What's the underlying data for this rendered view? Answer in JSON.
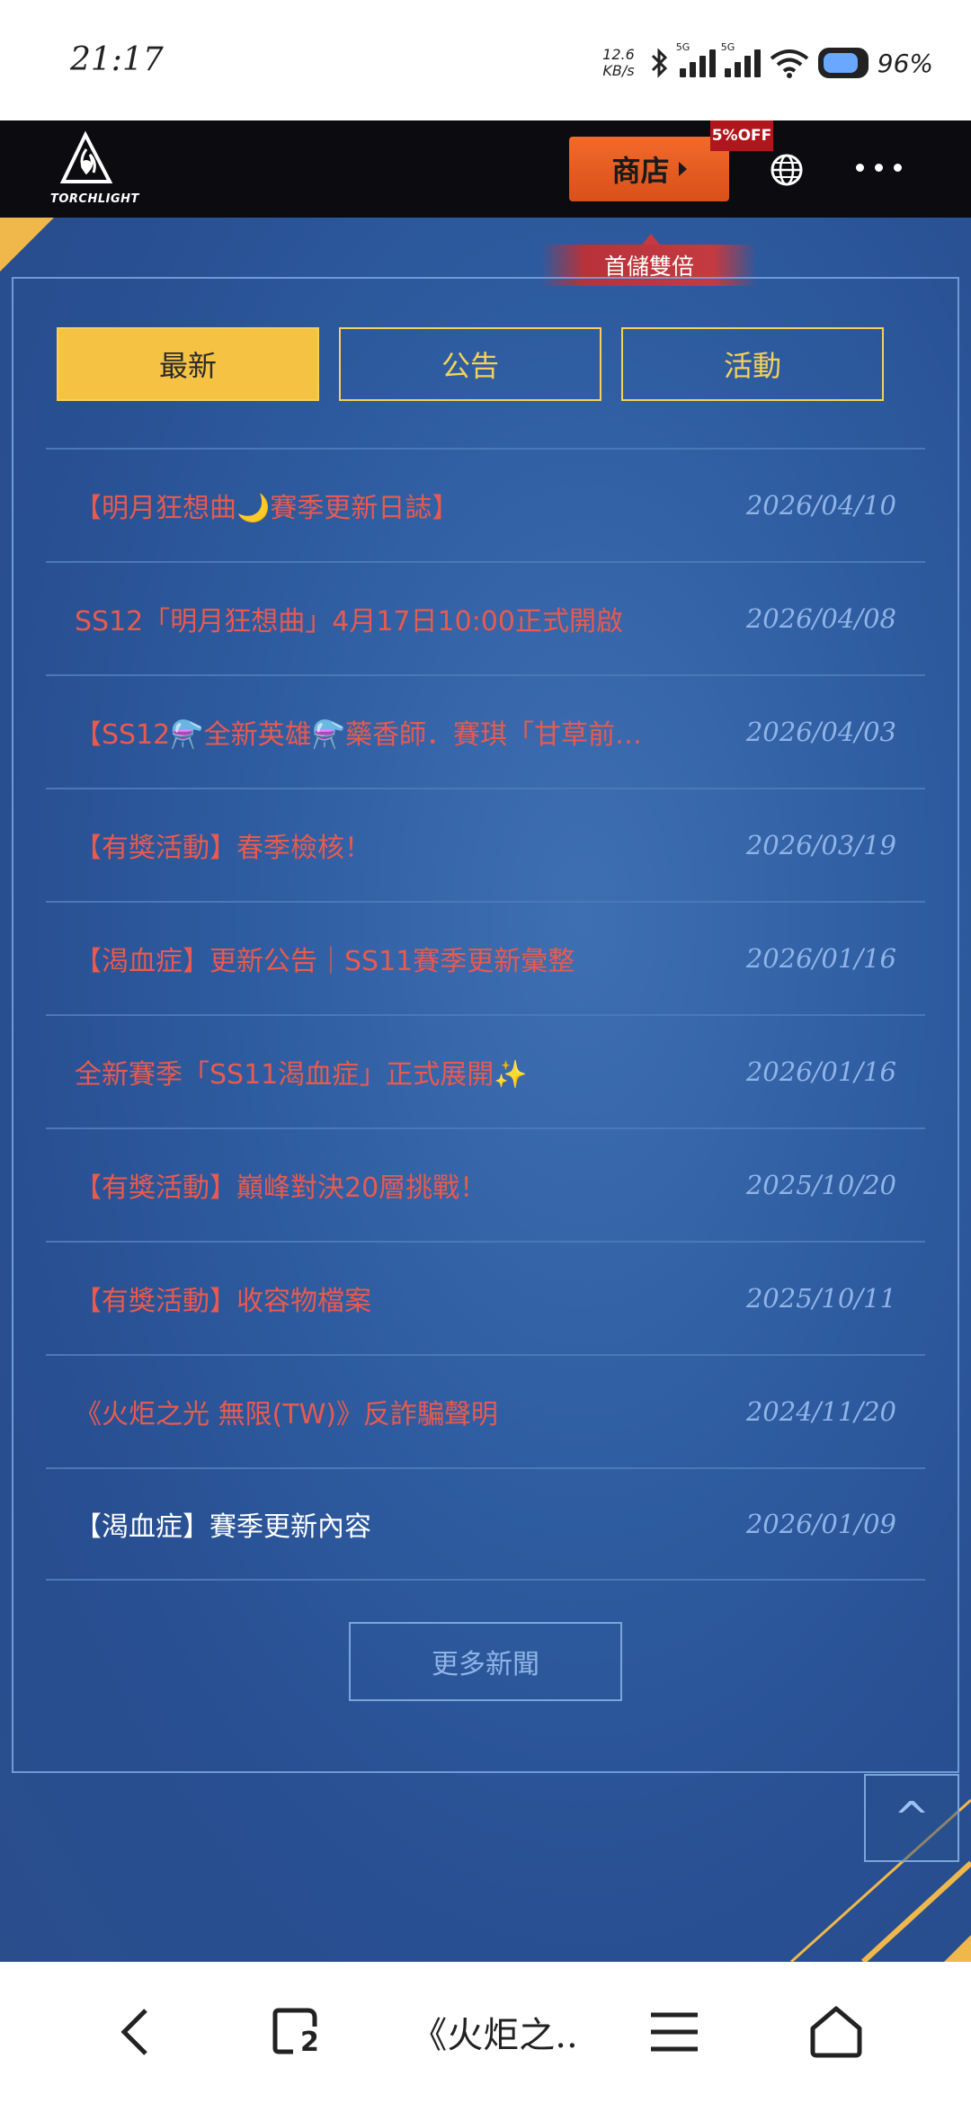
{
  "status_bar": {
    "time": "21:17",
    "net_speed_value": "12.6",
    "net_speed_unit": "KB/s",
    "signal_label": "5G",
    "battery": "96%"
  },
  "header": {
    "logo_text": "TORCHLIGHT",
    "shop_label": "商店",
    "discount_badge": "5%OFF",
    "first_recharge_banner": "首儲雙倍"
  },
  "tabs": [
    {
      "label": "最新",
      "active": true
    },
    {
      "label": "公告",
      "active": false
    },
    {
      "label": "活動",
      "active": false
    }
  ],
  "news": [
    {
      "title": "【明月狂想曲🌙賽季更新日誌】",
      "date": "2026/04/10",
      "read": false
    },
    {
      "title": "SS12「明月狂想曲」4月17日10:00正式開啟",
      "date": "2026/04/08",
      "read": false
    },
    {
      "title": "【SS12⚗️全新英雄⚗️藥香師．賽琪「甘草前…",
      "date": "2026/04/03",
      "read": false
    },
    {
      "title": "【有獎活動】春季檢核！",
      "date": "2026/03/19",
      "read": false
    },
    {
      "title": "【渴血症】更新公告｜SS11賽季更新彙整",
      "date": "2026/01/16",
      "read": false
    },
    {
      "title": "全新賽季「SS11渴血症」正式展開✨",
      "date": "2026/01/16",
      "read": false
    },
    {
      "title": "【有獎活動】巔峰對決20層挑戰！",
      "date": "2025/10/20",
      "read": false
    },
    {
      "title": "【有獎活動】收容物檔案",
      "date": "2025/10/11",
      "read": false
    },
    {
      "title": "《火炬之光 無限(TW)》反詐騙聲明",
      "date": "2024/11/20",
      "read": false
    },
    {
      "title": "【渴血症】賽季更新內容",
      "date": "2026/01/09",
      "read": true
    }
  ],
  "more_news_label": "更多新聞",
  "to_top_glyph": "^",
  "bottom_nav": {
    "tab_count": "2",
    "page_title": "《火炬之.."
  },
  "colors": {
    "accent_yellow": "#f5c244",
    "news_red": "#e85a4f",
    "shop_orange": "#e85e22",
    "panel_blue": "#2d5a9e"
  }
}
